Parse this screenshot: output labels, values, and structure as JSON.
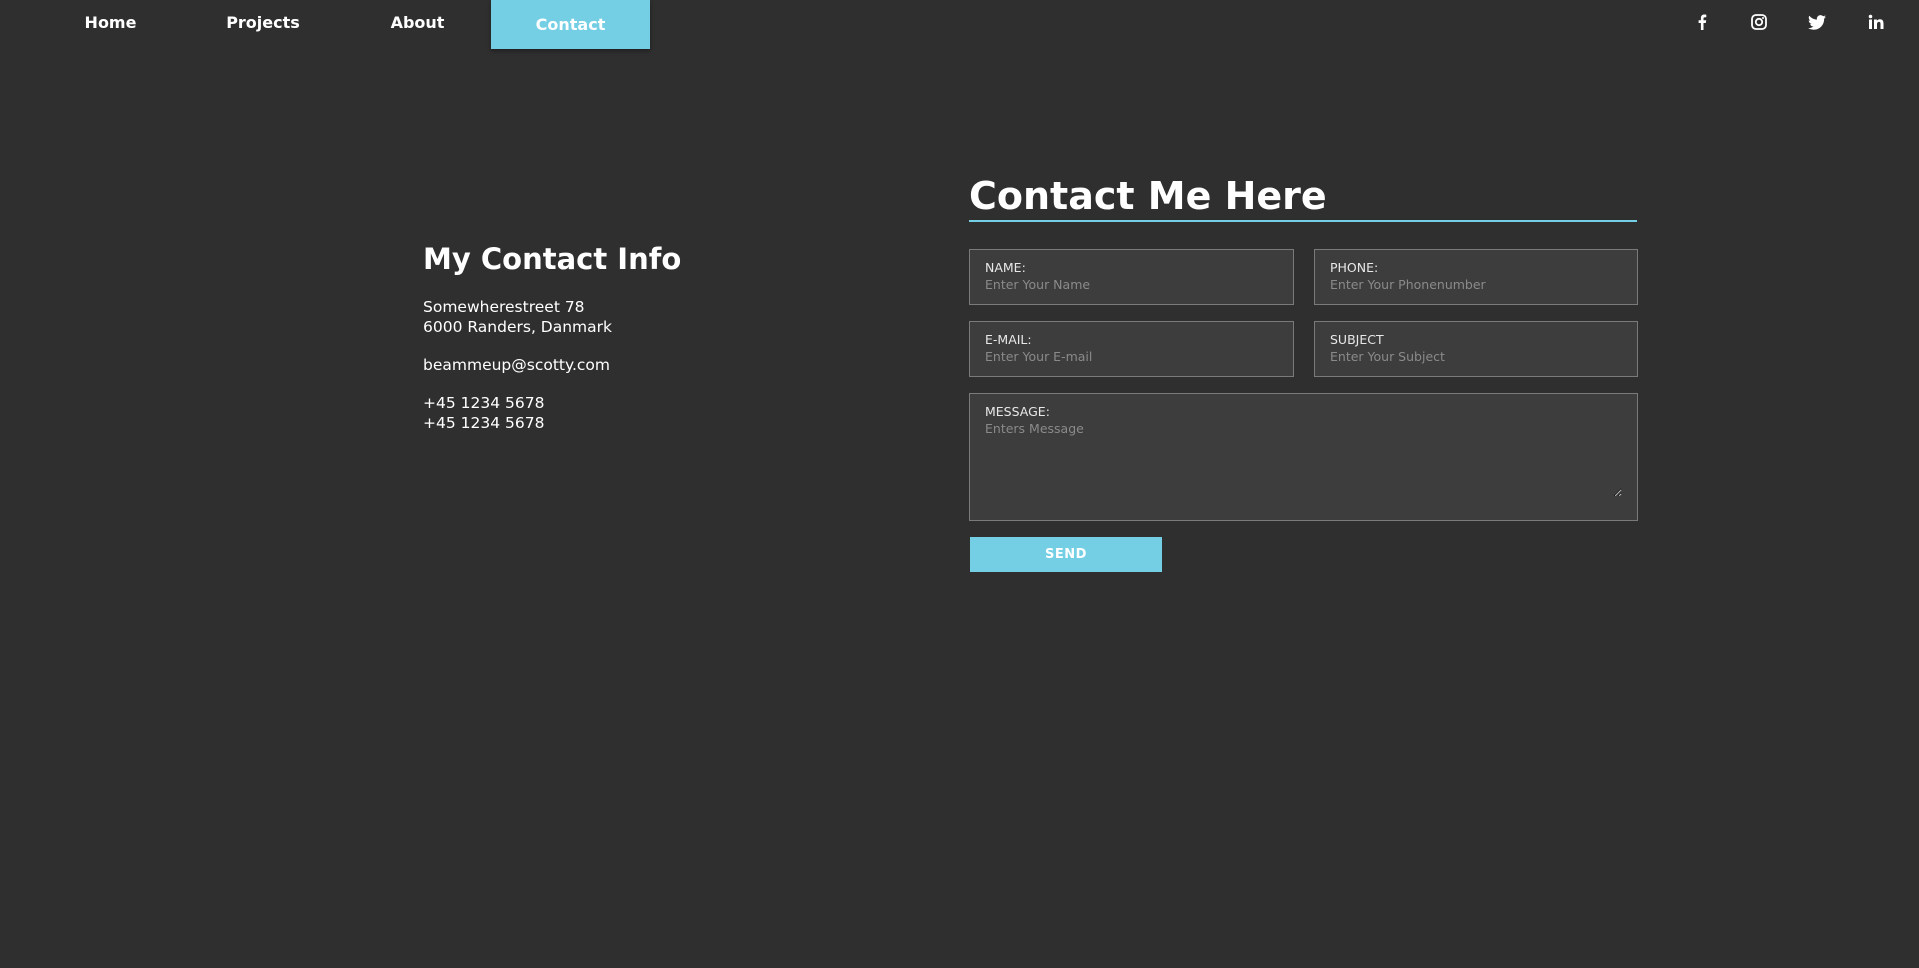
{
  "nav": {
    "items": [
      {
        "label": "Home"
      },
      {
        "label": "Projects"
      },
      {
        "label": "About"
      },
      {
        "label": "Contact",
        "active": true
      }
    ],
    "accent_color": "#74cfe5"
  },
  "social": [
    {
      "icon": "facebook-icon"
    },
    {
      "icon": "instagram-icon"
    },
    {
      "icon": "twitter-icon"
    },
    {
      "icon": "linkedin-icon"
    }
  ],
  "info": {
    "heading": "My Contact Info",
    "address_line1": "Somewherestreet 78",
    "address_line2": "6000 Randers, Danmark",
    "email": "beammeup@scotty.com",
    "phone1": "+45 1234 5678",
    "phone2": "+45 1234 5678"
  },
  "form": {
    "title": "Contact Me Here",
    "name": {
      "label": "NAME:",
      "placeholder": "Enter Your Name"
    },
    "phone": {
      "label": "PHONE:",
      "placeholder": "Enter Your Phonenumber"
    },
    "email": {
      "label": "E-MAIL:",
      "placeholder": "Enter Your E-mail"
    },
    "subject": {
      "label": "SUBJECT",
      "placeholder": "Enter Your Subject"
    },
    "message": {
      "label": "MESSAGE:",
      "placeholder": "Enters Message"
    },
    "send_label": "SEND"
  },
  "colors": {
    "background": "#2f2f2f",
    "accent": "#74cfe5",
    "field_bg": "#3d3d3d"
  }
}
